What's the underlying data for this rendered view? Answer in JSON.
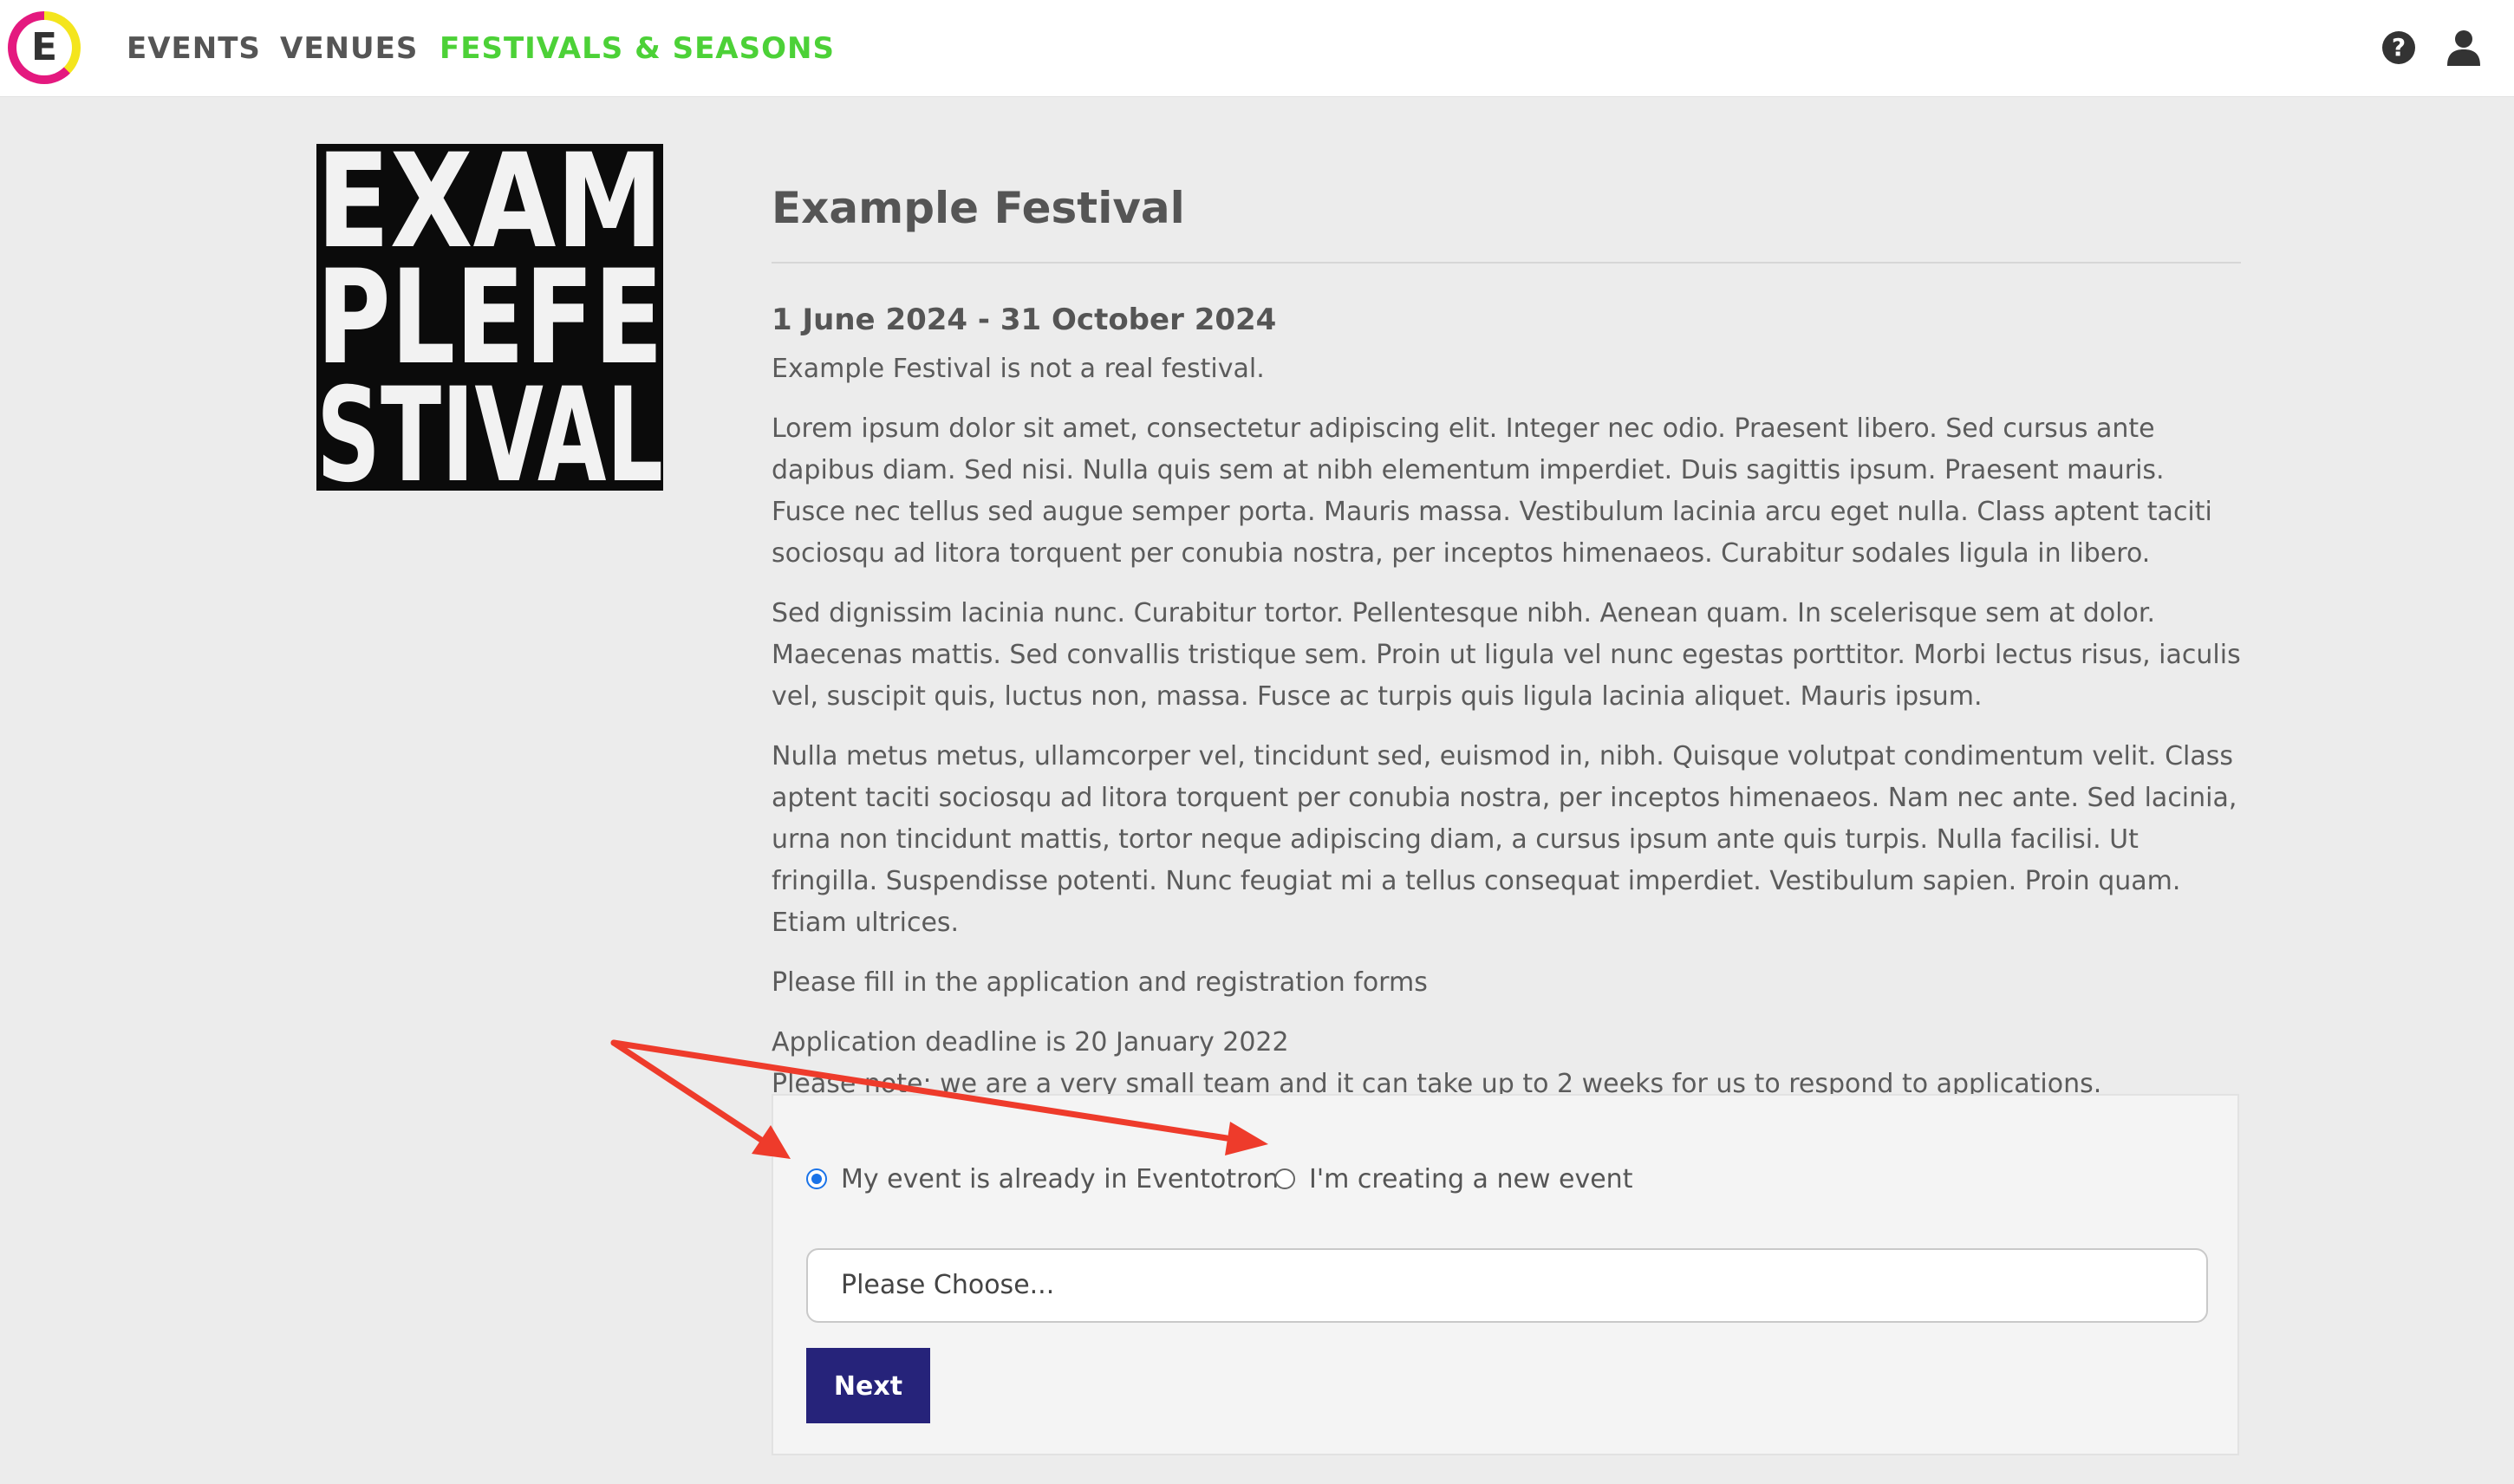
{
  "nav": {
    "logo_letter": "E",
    "items": [
      {
        "label": "EVENTS",
        "active": false
      },
      {
        "label": "VENUES",
        "active": false
      },
      {
        "label": "FESTIVALS & SEASONS",
        "active": true
      }
    ],
    "help_glyph": "?",
    "icons": [
      "help-icon",
      "user-icon"
    ],
    "active_color": "#4cd137"
  },
  "festival_image": {
    "lines": [
      "EXAM",
      "PLEFE",
      "STIVAL"
    ]
  },
  "main": {
    "title": "Example Festival",
    "dates": "1 June 2024 - 31 October 2024",
    "tagline": "Example Festival is not a real festival.",
    "paragraphs": [
      "Lorem ipsum dolor sit amet, consectetur adipiscing elit. Integer nec odio. Praesent libero. Sed cursus ante dapibus diam. Sed nisi. Nulla quis sem at nibh elementum imperdiet. Duis sagittis ipsum. Praesent mauris. Fusce nec tellus sed augue semper porta. Mauris massa. Vestibulum lacinia arcu eget nulla. Class aptent taciti sociosqu ad litora torquent per conubia nostra, per inceptos himenaeos. Curabitur sodales ligula in libero.",
      "Sed dignissim lacinia nunc. Curabitur tortor. Pellentesque nibh. Aenean quam. In scelerisque sem at dolor. Maecenas mattis. Sed convallis tristique sem. Proin ut ligula vel nunc egestas porttitor. Morbi lectus risus, iaculis vel, suscipit quis, luctus non, massa. Fusce ac turpis quis ligula lacinia aliquet. Mauris ipsum.",
      "Nulla metus metus, ullamcorper vel, tincidunt sed, euismod in, nibh. Quisque volutpat condimentum velit. Class aptent taciti sociosqu ad litora torquent per conubia nostra, per inceptos himenaeos. Nam nec ante. Sed lacinia, urna non tincidunt mattis, tortor neque adipiscing diam, a cursus ipsum ante quis turpis. Nulla facilisi. Ut fringilla. Suspendisse potenti. Nunc feugiat mi a tellus consequat imperdiet. Vestibulum sapien. Proin quam. Etiam ultrices."
    ],
    "forms_note": "Please fill in the application and registration forms",
    "deadline": "Application deadline is 20 January 2022",
    "response_note": "Please note: we are a very small team and it can take up to 2 weeks for us to respond to applications."
  },
  "form": {
    "options": [
      {
        "label": "My event is already in Eventotron",
        "checked": true
      },
      {
        "label": "I'm creating a new event",
        "checked": false
      }
    ],
    "select_value": "Please Choose...",
    "next_label": "Next"
  },
  "colors": {
    "button": "#26237a",
    "radio_checked": "#1a73e8",
    "annotation_arrow": "#ee3b2b",
    "logo_ring_pink": "#e4197f",
    "logo_ring_yellow": "#f4e51d"
  }
}
